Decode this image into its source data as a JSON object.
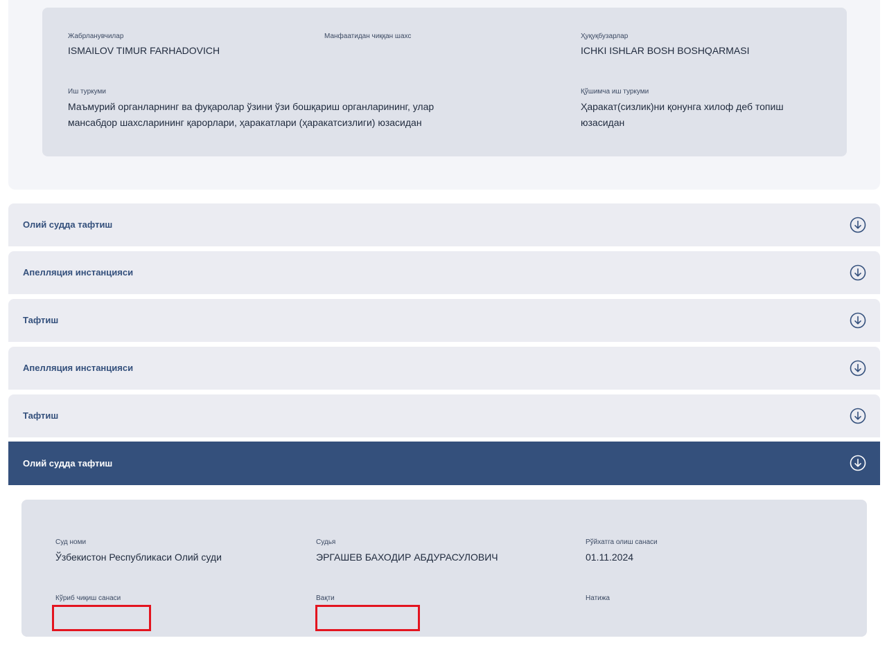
{
  "case_info": {
    "victims_label": "Жабрланувчилар",
    "victims_value": "ISMAILOV TIMUR FARHADOVICH",
    "interested_label": "Манфаатидан чиққан шахс",
    "violators_label": "Ҳуқуқбузарлар",
    "violators_value": "ICHKI ISHLAR BOSH BOSHQARMASI",
    "case_type_label": "Иш туркуми",
    "case_type_line1": "Маъмурий органларнинг ва фуқаролар ўзини ўзи бошқариш органларининг, улар",
    "case_type_line2": "мансабдор шахсларининг қарорлари, ҳаракатлари (ҳаракатсизлиги) юзасидан",
    "extra_type_label": "Қўшимча иш туркуми",
    "extra_type_line1": "Ҳаракат(сизлик)ни қонунга хилоф деб топиш",
    "extra_type_line2": "юзасидан"
  },
  "accordion": [
    {
      "title": "Олий судда тафтиш",
      "active": false
    },
    {
      "title": "Апелляция инстанцияси",
      "active": false
    },
    {
      "title": "Тафтиш",
      "active": false
    },
    {
      "title": "Апелляция инстанцияси",
      "active": false
    },
    {
      "title": "Тафтиш",
      "active": false
    },
    {
      "title": "Олий судда тафтиш",
      "active": true
    }
  ],
  "detail": {
    "court_label": "Суд номи",
    "court_value": "Ўзбекистон Республикаси Олий суди",
    "judge_label": "Судья",
    "judge_value": "ЭРГАШЕВ БАХОДИР АБДУРАСУЛОВИЧ",
    "reg_date_label": "Рўйхатга олиш санаси",
    "reg_date_value": "01.11.2024",
    "review_date_label": "Кўриб чиқиш санаси",
    "review_date_value": "",
    "time_label": "Вақти",
    "time_value": "",
    "result_label": "Натижа",
    "result_value": ""
  },
  "icons": {
    "accordion_toggle": "arrow-down-circle-icon"
  },
  "colors": {
    "accent": "#34507c",
    "panel": "#dfe2ea",
    "highlight_box": "#e3141f"
  }
}
